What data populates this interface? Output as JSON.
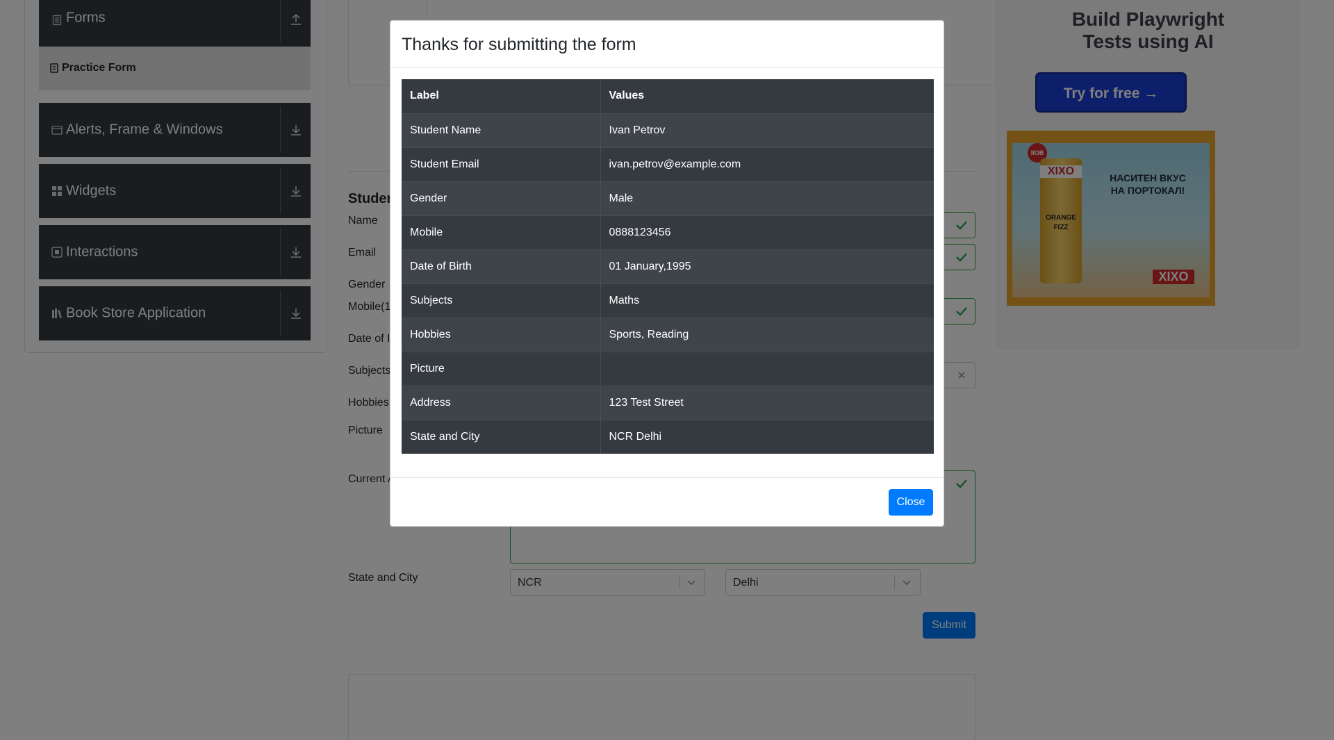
{
  "sidebar": {
    "groups": [
      {
        "label": "Forms",
        "icon": "forms-icon",
        "arrow": "collapse-arrow-icon"
      },
      {
        "label": "Alerts, Frame & Windows",
        "icon": "window-icon",
        "arrow": "expand-arrow-icon"
      },
      {
        "label": "Widgets",
        "icon": "widgets-icon",
        "arrow": "expand-arrow-icon"
      },
      {
        "label": "Interactions",
        "icon": "interactions-icon",
        "arrow": "expand-arrow-icon"
      },
      {
        "label": "Book Store Application",
        "icon": "books-icon",
        "arrow": "expand-arrow-icon"
      }
    ],
    "active_item": "Practice Form"
  },
  "form": {
    "title": "Studer",
    "labels": {
      "name": "Name",
      "email": "Email",
      "gender": "Gender",
      "mobile": "Mobile(1",
      "dob": "Date of I",
      "subjects": "Subjects",
      "hobbies": "Hobbies",
      "picture": "Picture",
      "current_address": "Current A",
      "state_city": "State and City"
    },
    "state_value": "NCR",
    "city_value": "Delhi",
    "submit_label": "Submit"
  },
  "ad": {
    "headline_line1": "Build Playwright",
    "headline_line2": "Tests using AI",
    "button_label": "Try for free →",
    "image_brand": "XIXO",
    "image_tagline_1": "НАСИТЕН ВКУС",
    "image_tagline_2": "НА ПОРТОКАЛ!",
    "image_badge": "IIOB",
    "can_text_1": "ORANGE",
    "can_text_2": "FIZZ"
  },
  "modal": {
    "title": "Thanks for submitting the form",
    "header": {
      "label": "Label",
      "values": "Values"
    },
    "rows": [
      {
        "label": "Student Name",
        "value": "Ivan Petrov"
      },
      {
        "label": "Student Email",
        "value": "ivan.petrov@example.com"
      },
      {
        "label": "Gender",
        "value": "Male"
      },
      {
        "label": "Mobile",
        "value": "0888123456"
      },
      {
        "label": "Date of Birth",
        "value": "01 January,1995"
      },
      {
        "label": "Subjects",
        "value": "Maths"
      },
      {
        "label": "Hobbies",
        "value": "Sports, Reading"
      },
      {
        "label": "Picture",
        "value": ""
      },
      {
        "label": "Address",
        "value": "123 Test Street"
      },
      {
        "label": "State and City",
        "value": "NCR Delhi"
      }
    ],
    "close_label": "Close"
  },
  "colors": {
    "primary": "#007bff",
    "dark": "#343a40",
    "success": "#28a745",
    "ad_button": "#1b3ed6"
  }
}
